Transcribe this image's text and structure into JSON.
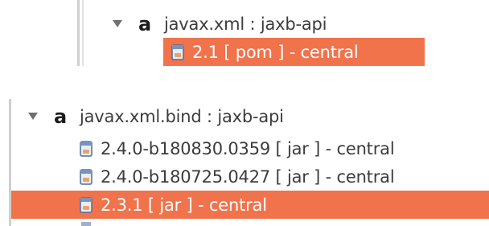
{
  "colors": {
    "selection": "#f0734c",
    "text": "#3c3c3c",
    "selected_text": "#ffffff"
  },
  "tree1": {
    "group": {
      "badge": "a",
      "label": "javax.xml : jaxb-api",
      "icon": "artifact-group-icon",
      "expanded": true
    },
    "versions": [
      {
        "label": "2.1 [ pom ] - central",
        "icon": "jar-icon",
        "selected": true
      }
    ]
  },
  "tree2": {
    "group": {
      "badge": "a",
      "label": "javax.xml.bind : jaxb-api",
      "icon": "artifact-group-icon",
      "expanded": true
    },
    "versions": [
      {
        "label": "2.4.0-b180830.0359 [ jar ] - central",
        "icon": "jar-icon",
        "selected": false
      },
      {
        "label": "2.4.0-b180725.0427 [ jar ] - central",
        "icon": "jar-icon",
        "selected": false
      },
      {
        "label": "2.3.1 [ jar ] - central",
        "icon": "jar-icon",
        "selected": true
      }
    ]
  }
}
